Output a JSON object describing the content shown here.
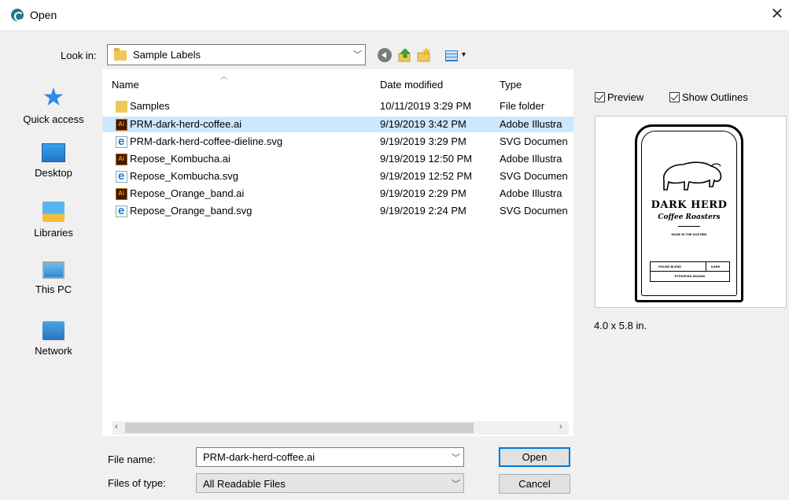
{
  "window": {
    "title": "Open"
  },
  "look_in": {
    "label": "Look in:",
    "value": "Sample Labels"
  },
  "places": [
    {
      "label": "Quick access",
      "icon": "quick-access-star-icon"
    },
    {
      "label": "Desktop",
      "icon": "desktop-icon"
    },
    {
      "label": "Libraries",
      "icon": "libraries-icon"
    },
    {
      "label": "This PC",
      "icon": "this-pc-icon"
    },
    {
      "label": "Network",
      "icon": "network-icon"
    }
  ],
  "columns": {
    "name": "Name",
    "date": "Date modified",
    "type": "Type"
  },
  "files": [
    {
      "name": "Samples",
      "date": "10/11/2019 3:29 PM",
      "type": "File folder",
      "icon": "folder-icon",
      "selected": false
    },
    {
      "name": "PRM-dark-herd-coffee.ai",
      "date": "9/19/2019 3:42 PM",
      "type": "Adobe Illustra",
      "icon": "illustrator-file-icon",
      "selected": true
    },
    {
      "name": "PRM-dark-herd-coffee-dieline.svg",
      "date": "9/19/2019 3:29 PM",
      "type": "SVG Documen",
      "icon": "svg-file-icon",
      "selected": false
    },
    {
      "name": "Repose_Kombucha.ai",
      "date": "9/19/2019 12:50 PM",
      "type": "Adobe Illustra",
      "icon": "illustrator-file-icon",
      "selected": false
    },
    {
      "name": "Repose_Kombucha.svg",
      "date": "9/19/2019 12:52 PM",
      "type": "SVG Documen",
      "icon": "svg-file-icon",
      "selected": false
    },
    {
      "name": "Repose_Orange_band.ai",
      "date": "9/19/2019 2:29 PM",
      "type": "Adobe Illustra",
      "icon": "illustrator-file-icon",
      "selected": false
    },
    {
      "name": "Repose_Orange_band.svg",
      "date": "9/19/2019 2:24 PM",
      "type": "SVG Documen",
      "icon": "svg-file-icon",
      "selected": false
    }
  ],
  "preview": {
    "preview_label": "Preview",
    "preview_checked": true,
    "outlines_label": "Show Outlines",
    "outlines_checked": true,
    "dimensions": "4.0 x 5.8 in.",
    "label_art": {
      "brand": "DARK HERD",
      "subtitle": "Coffee Roasters",
      "made": "MADE IN THE DUSTBIN",
      "blend": "HOUSE BLEND",
      "roast": "DARK",
      "origin": "ETHIOPIAN SIDAMA"
    }
  },
  "file_name": {
    "label": "File name:",
    "value": "PRM-dark-herd-coffee.ai"
  },
  "file_type": {
    "label": "Files of type:",
    "value": "All Readable Files"
  },
  "buttons": {
    "open": "Open",
    "cancel": "Cancel"
  },
  "colors": {
    "selection": "#cce8ff",
    "accent": "#0078d7",
    "dialog_bg": "#f0f0f0"
  }
}
